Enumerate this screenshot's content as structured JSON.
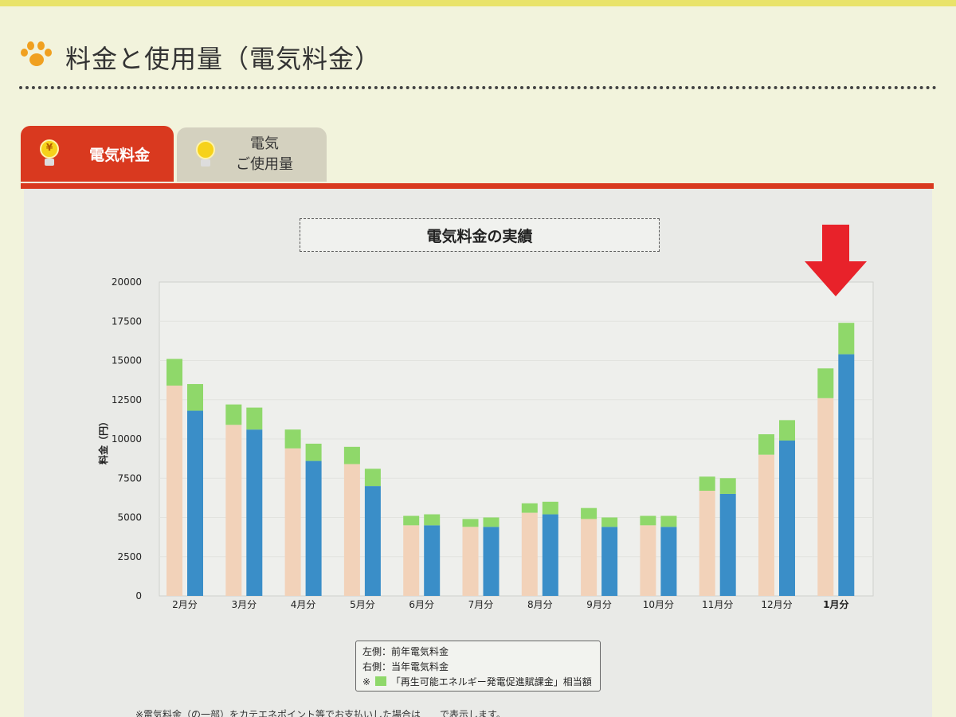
{
  "page": {
    "title": "料金と使用量（電気料金）",
    "icon": "paw-icon"
  },
  "tabs": [
    {
      "label": "電気料金",
      "icon": "yen-bulb-icon",
      "active": true
    },
    {
      "label_line1": "電気",
      "label_line2": "ご使用量",
      "icon": "bulb-icon",
      "active": false
    }
  ],
  "colors": {
    "accent_red": "#d9391f",
    "prev_year": "#f2d2b9",
    "current_year": "#3a8ec8",
    "renewable_levy": "#8fd86a",
    "arrow": "#e8222a"
  },
  "chart_data": {
    "type": "bar",
    "title": "電気料金の実績",
    "ylabel": "料金（円）",
    "ylim": [
      0,
      20000
    ],
    "yticks": [
      "20000",
      "17500",
      "15000",
      "12500",
      "10000",
      "7500",
      "5000",
      "2500",
      "0"
    ],
    "categories": [
      "2月分",
      "3月分",
      "4月分",
      "5月分",
      "6月分",
      "7月分",
      "8月分",
      "9月分",
      "10月分",
      "11月分",
      "12月分",
      "1月分"
    ],
    "series": [
      {
        "name": "前年電気料金",
        "values": [
          13400,
          10900,
          9400,
          8400,
          4500,
          4400,
          5300,
          4900,
          4500,
          6700,
          9000,
          12600
        ],
        "levy": [
          1700,
          1300,
          1200,
          1100,
          600,
          500,
          600,
          700,
          600,
          900,
          1300,
          1900
        ]
      },
      {
        "name": "当年電気料金",
        "values": [
          11800,
          10600,
          8600,
          7000,
          4500,
          4400,
          5200,
          4400,
          4400,
          6500,
          9900,
          15400
        ],
        "levy": [
          1700,
          1400,
          1100,
          1100,
          700,
          600,
          800,
          600,
          700,
          1000,
          1300,
          2000
        ]
      }
    ]
  },
  "legend": {
    "line1": "左側：前年電気料金",
    "line2": "右側：当年電気料金",
    "line3_prefix": "※",
    "line3_text": "「再生可能エネルギー発電促進賦課金」相当額"
  },
  "footnote": "※電気料金（の一部）をカテエネポイント等でお支払いした場合は　　で表示します。"
}
